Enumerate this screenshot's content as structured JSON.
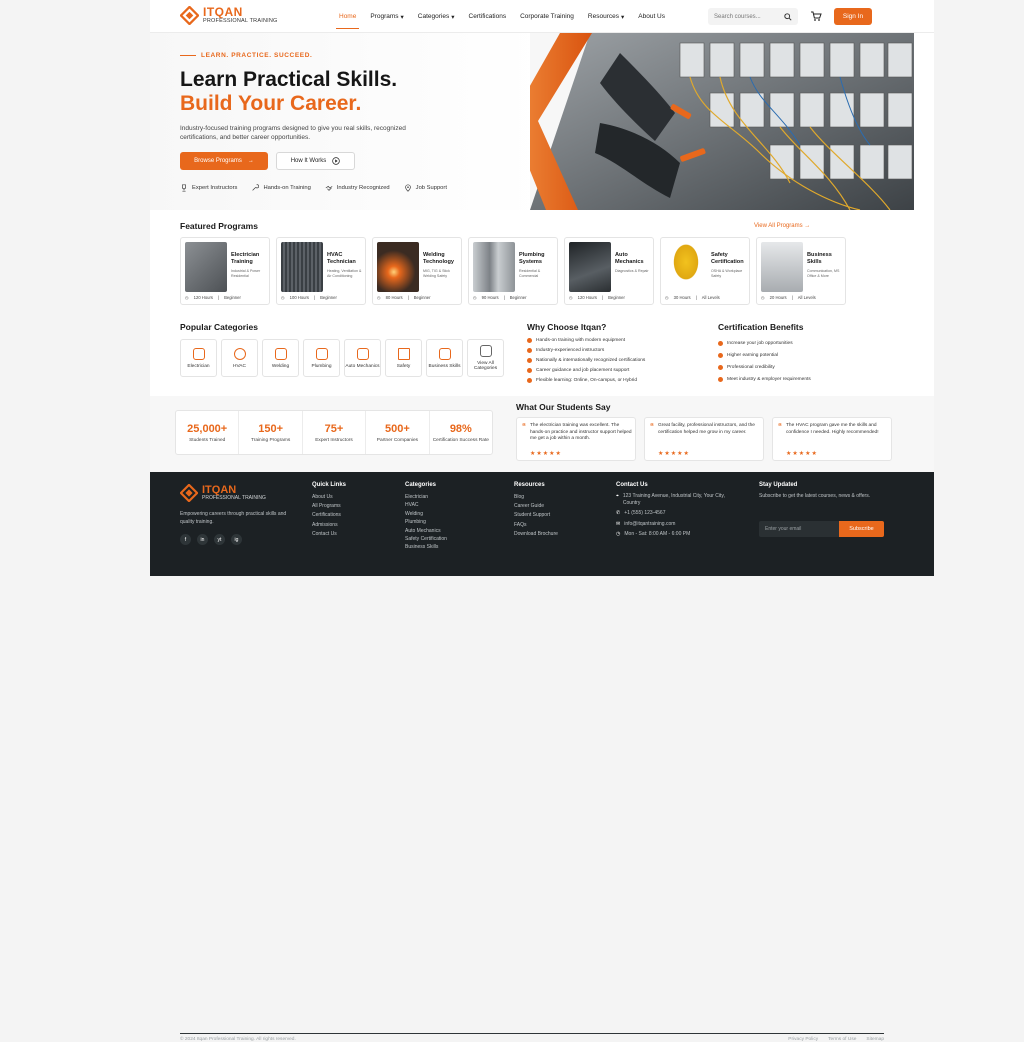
{
  "header": {
    "logo_title": "ITQAN",
    "logo_subtitle": "PROFESSIONAL TRAINING",
    "nav": [
      {
        "label": "Home"
      },
      {
        "label": "Programs"
      },
      {
        "label": "Categories"
      },
      {
        "label": "Certifications"
      },
      {
        "label": "Corporate Training"
      },
      {
        "label": "Resources"
      },
      {
        "label": "About Us"
      }
    ],
    "search_placeholder": "Search courses...",
    "signin_label": "Sign In"
  },
  "hero": {
    "tagline": "LEARN. PRACTICE. SUCCEED.",
    "title_line1": "Learn Practical Skills.",
    "title_line2": "Build Your Career.",
    "subtitle": "Industry-focused training programs designed to give you real skills, recognized certifications, and better career opportunities.",
    "primary_button": "Browse Programs",
    "secondary_button": "How It Works",
    "features": [
      "Expert Instructors",
      "Hands-on Training",
      "Industry Recognized",
      "Job Support"
    ]
  },
  "featured": {
    "title": "Featured Programs",
    "view_all": "View All Programs",
    "programs": [
      {
        "title": "Electrician Training",
        "desc": "Industrial & Power Residential",
        "hours": "120 Hours",
        "level": "Beginner",
        "color": "#6b6f72"
      },
      {
        "title": "HVAC Technician",
        "desc": "Heating, Ventilation & Air Conditioning",
        "hours": "100 Hours",
        "level": "Beginner",
        "color": "#4a4f55"
      },
      {
        "title": "Welding Technology",
        "desc": "MIG, TIG & Stick Welding Safety",
        "hours": "80 Hours",
        "level": "Beginner",
        "color": "#3b2b22"
      },
      {
        "title": "Plumbing Systems",
        "desc": "Residential & Commercial",
        "hours": "90 Hours",
        "level": "Beginner",
        "color": "#8a8f94"
      },
      {
        "title": "Auto Mechanics",
        "desc": "Diagnostics & Repair",
        "hours": "120 Hours",
        "level": "Beginner",
        "color": "#2f3337"
      },
      {
        "title": "Safety Certification",
        "desc": "OSHA & Workplace Safety",
        "hours": "30 Hours",
        "level": "All Levels",
        "color": "#e3b21c"
      },
      {
        "title": "Business Skills",
        "desc": "Communication, MS Office & More",
        "hours": "20 Hours",
        "level": "All Levels",
        "color": "#b9bcbf"
      }
    ]
  },
  "categories": {
    "title": "Popular Categories",
    "items": [
      "Electrician",
      "HVAC",
      "Welding",
      "Plumbing",
      "Auto Mechanics",
      "Safety",
      "Business Skills",
      "View All Categories"
    ]
  },
  "why": {
    "title": "Why Choose Itqan?",
    "items": [
      "Hands-on training with modern equipment",
      "Industry-experienced instructors",
      "Nationally & internationally recognized certifications",
      "Career guidance and job placement support",
      "Flexible learning: Online, On-campus, or Hybrid"
    ]
  },
  "benefits": {
    "title": "Certification Benefits",
    "items": [
      "Increase your job opportunities",
      "Higher earning potential",
      "Professional credibility",
      "Meet industry & employer requirements"
    ]
  },
  "stats": [
    {
      "value": "25,000+",
      "label": "Students Trained"
    },
    {
      "value": "150+",
      "label": "Training Programs"
    },
    {
      "value": "75+",
      "label": "Expert Instructors"
    },
    {
      "value": "500+",
      "label": "Partner Companies"
    },
    {
      "value": "98%",
      "label": "Certification Success Rate"
    }
  ],
  "testimonials": {
    "title": "What Our Students Say",
    "items": [
      {
        "text": "The electrician training was excellent. The hands-on practice and instructor support helped me get a job within a month.",
        "stars": "★★★★★"
      },
      {
        "text": "Great facility, professional instructors, and the certification helped me grow in my career.",
        "stars": "★★★★★"
      },
      {
        "text": "The HVAC program gave me the skills and confidence I needed. Highly recommended!",
        "stars": "★★★★★"
      }
    ]
  },
  "footer": {
    "logo_title": "ITQAN",
    "logo_subtitle": "PROFESSIONAL TRAINING",
    "about": "Empowering careers through practical skills and quality training.",
    "social": [
      "f",
      "in",
      "yt",
      "ig"
    ],
    "quick_links_title": "Quick Links",
    "quick_links": [
      "About Us",
      "All Programs",
      "Certifications",
      "Admissions",
      "Contact Us"
    ],
    "categories_title": "Categories",
    "categories": [
      "Electrician",
      "HVAC",
      "Welding",
      "Plumbing",
      "Auto Mechanics",
      "Safety Certification",
      "Business Skills"
    ],
    "resources_title": "Resources",
    "resources": [
      "Blog",
      "Career Guide",
      "Student Support",
      "FAQs",
      "Download Brochure"
    ],
    "contact_title": "Contact Us",
    "address": "123 Training Avenue, Industrial City, Your City, Country",
    "phone": "+1 (555) 123-4567",
    "email": "info@itqantraining.com",
    "hours": "Mon - Sat: 8:00 AM - 6:00 PM",
    "newsletter_title": "Stay Updated",
    "newsletter_text": "Subscribe to get the latest courses, news & offers.",
    "email_placeholder": "Enter your email",
    "subscribe_label": "Subscribe",
    "copyright": "© 2024 Itqan Professional Training. All rights reserved.",
    "bottom_links": [
      "Privacy Policy",
      "Terms of Use",
      "Sitemap"
    ]
  },
  "colors": {
    "accent": "#e8681c",
    "footer_bg": "#1c2124"
  }
}
